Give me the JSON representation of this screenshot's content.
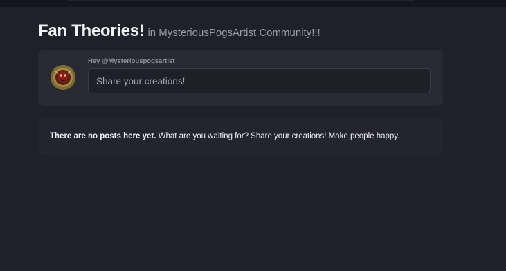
{
  "header": {
    "title": "Fan Theories!",
    "subtitle": "in MysteriousPogsArtist Community!!!"
  },
  "composer": {
    "greeting": "Hey @Mysteriouspogsartist",
    "placeholder": "Share your creations!",
    "avatar_icon": "user-avatar"
  },
  "empty_state": {
    "bold_text": "There are no posts here yet.",
    "message": " What are you waiting for? Share your creations! Make people happy."
  },
  "colors": {
    "background": "#1f2029",
    "card": "#282933",
    "title": "#f2f3f5",
    "muted": "#9b9ca8"
  }
}
